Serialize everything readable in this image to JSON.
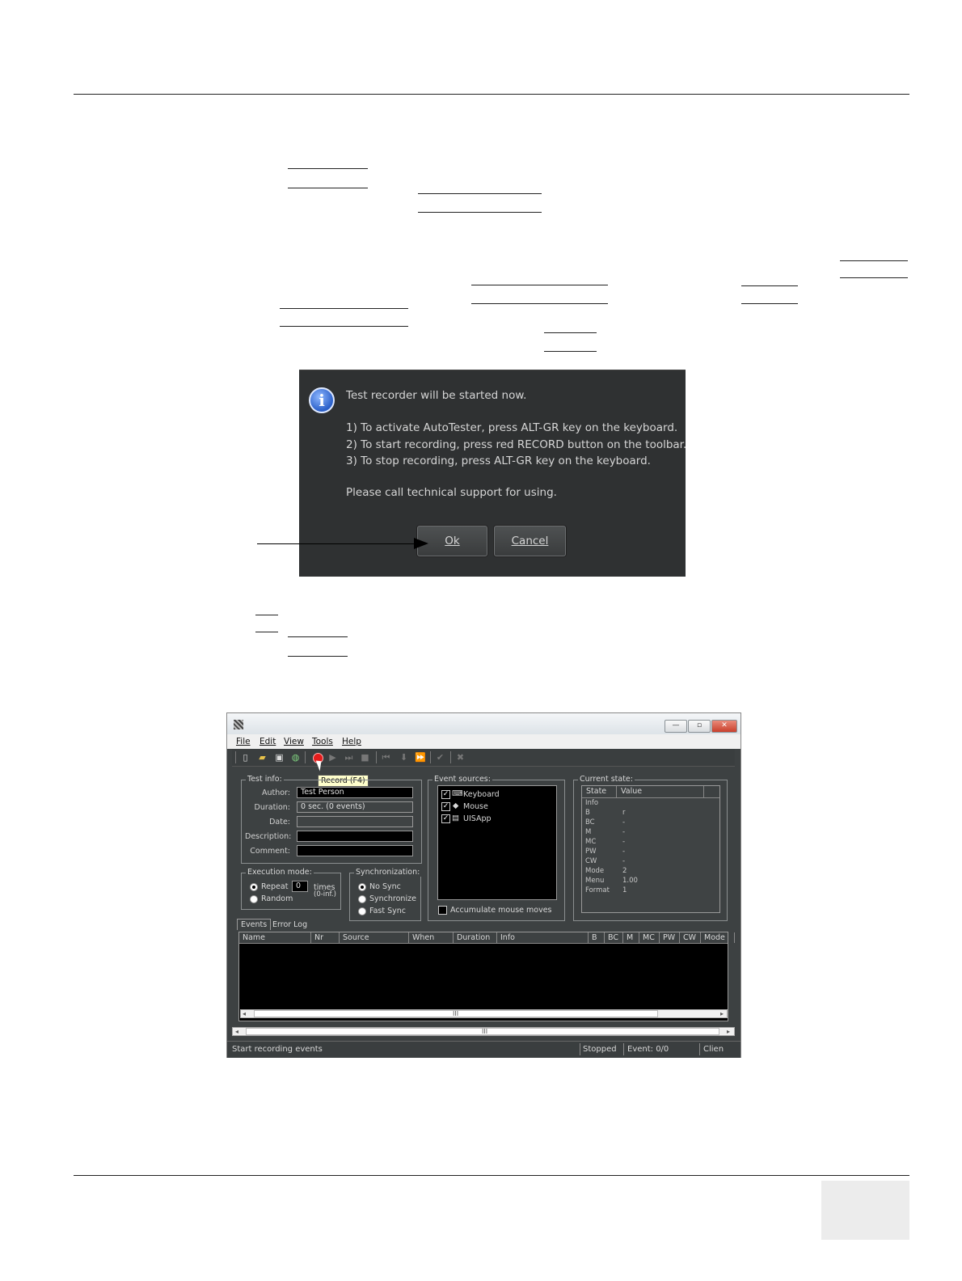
{
  "dialog": {
    "line1": "Test recorder will be started now.",
    "line2": "1) To activate AutoTester, press ALT-GR key on the keyboard.",
    "line3": "2) To start recording, press red RECORD button on the toolbar.",
    "line4": "3) To stop recording, press ALT-GR key on the keyboard.",
    "line5": "Please call technical support for using.",
    "ok_label": "Ok",
    "cancel_label": "Cancel"
  },
  "app": {
    "menu": [
      "File",
      "Edit",
      "View",
      "Tools",
      "Help"
    ],
    "tooltip": "Record (F4)",
    "test_info": {
      "title": "Test info:",
      "author_label": "Author:",
      "author_value": "Test Person",
      "duration_label": "Duration:",
      "duration_value": "0 sec. (0 events)",
      "date_label": "Date:",
      "description_label": "Description:",
      "comment_label": "Comment:"
    },
    "event_sources": {
      "title": "Event sources:",
      "items": [
        "Keyboard",
        "Mouse",
        "UISApp"
      ],
      "accumulate": "Accumulate mouse moves"
    },
    "current_state": {
      "title": "Current state:",
      "col_state": "State",
      "col_value": "Value",
      "rows": [
        [
          "Info",
          ""
        ],
        [
          "B",
          "r"
        ],
        [
          "BC",
          "-"
        ],
        [
          "M",
          "-"
        ],
        [
          "MC",
          "-"
        ],
        [
          "PW",
          "-"
        ],
        [
          "CW",
          "-"
        ],
        [
          "Mode",
          "2"
        ],
        [
          "Menu",
          "1.00"
        ],
        [
          "Format",
          "1"
        ]
      ]
    },
    "execution_mode": {
      "title": "Execution mode:",
      "repeat": "Repeat",
      "repeat_value": "0",
      "times": "times",
      "times_sub": "(0-inf.)",
      "random": "Random"
    },
    "synchronization": {
      "title": "Synchronization:",
      "options": [
        "No Sync",
        "Synchronize",
        "Fast Sync"
      ]
    },
    "tabs": [
      "Events",
      "Error Log"
    ],
    "columns": [
      "Name",
      "Nr",
      "Source",
      "When",
      "Duration",
      "Info",
      "B",
      "BC",
      "M",
      "MC",
      "PW",
      "CW",
      "Mode"
    ],
    "scroll_mark": "III",
    "status": {
      "text": "Start recording events",
      "state": "Stopped",
      "event": "Event: 0/0",
      "client": "Clien"
    }
  }
}
